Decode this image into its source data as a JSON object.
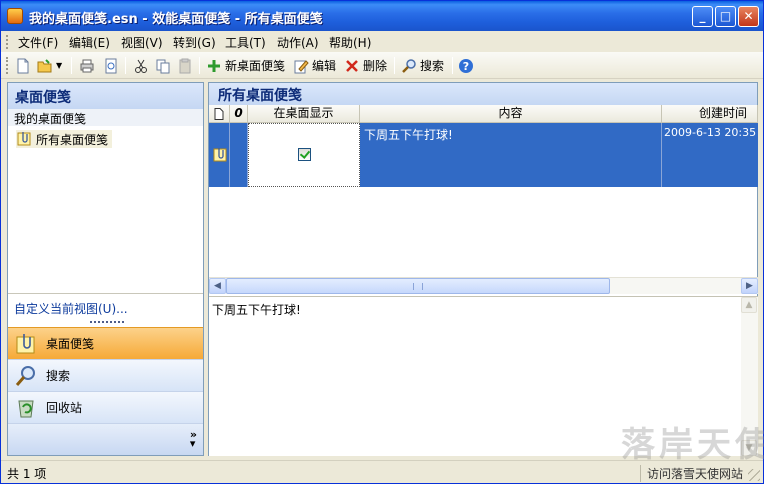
{
  "window": {
    "title": "我的桌面便笺.esn - 效能桌面便笺 - 所有桌面便笺",
    "minimize": "_",
    "maximize": "□",
    "close": "✕"
  },
  "menu": [
    "文件(F)",
    "编辑(E)",
    "视图(V)",
    "转到(G)",
    "工具(T)",
    "动作(A)",
    "帮助(H)"
  ],
  "toolbar": {
    "new_note": "新桌面便笺",
    "edit": "编辑",
    "delete": "删除",
    "search": "搜索"
  },
  "left": {
    "header": "桌面便笺",
    "group": "我的桌面便笺",
    "tree_item": "所有桌面便笺",
    "customize": "自定义当前视图(U)...",
    "nav": [
      {
        "label": "桌面便笺",
        "icon": "notes-icon"
      },
      {
        "label": "搜索",
        "icon": "search-icon"
      },
      {
        "label": "回收站",
        "icon": "recycle-bin-icon"
      }
    ],
    "more": "»"
  },
  "right": {
    "header": "所有桌面便笺",
    "columns": {
      "paperclip": "0",
      "show_on_desktop": "在桌面显示",
      "content": "内容",
      "created": "创建时间"
    },
    "rows": [
      {
        "content": "下周五下午打球!",
        "created": "2009-6-13 20:35",
        "show_on_desktop": true
      }
    ],
    "preview_text": "下周五下午打球!"
  },
  "status": {
    "count": "共 1 项",
    "right": "访问落雪天使网站"
  },
  "watermark": "落岸天使",
  "colors": {
    "title_blue": "#1e5fdc",
    "selection": "#316ac5",
    "active_nav": "#f6a937",
    "pane_header_text": "#0d2b78"
  }
}
